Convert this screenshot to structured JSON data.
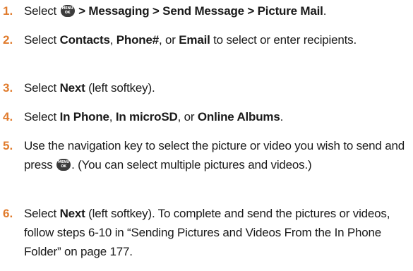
{
  "steps": [
    {
      "number": "1.",
      "parts": [
        {
          "t": "Select "
        },
        {
          "icon": "menu-ok-key"
        },
        {
          "b": " > Messaging > Send Message > Picture Mail"
        },
        {
          "t": "."
        }
      ]
    },
    {
      "number": "2.",
      "parts": [
        {
          "t": "Select "
        },
        {
          "b": "Contacts"
        },
        {
          "t": ", "
        },
        {
          "b": "Phone#"
        },
        {
          "t": ", or "
        },
        {
          "b": "Email"
        },
        {
          "t": " to select or enter recipients."
        }
      ]
    },
    {
      "number": "3.",
      "parts": [
        {
          "t": "Select "
        },
        {
          "b": "Next"
        },
        {
          "t": " (left softkey)."
        }
      ]
    },
    {
      "number": "4.",
      "parts": [
        {
          "t": "Select "
        },
        {
          "b": "In Phone"
        },
        {
          "t": ", "
        },
        {
          "b": "In microSD"
        },
        {
          "t": ", or "
        },
        {
          "b": "Online Albums"
        },
        {
          "t": "."
        }
      ]
    },
    {
      "number": "5.",
      "parts": [
        {
          "t": "Use the navigation key to select the picture or video you wish to send and press "
        },
        {
          "icon": "menu-ok-key"
        },
        {
          "t": ". (You can select multiple pictures and videos.)"
        }
      ]
    },
    {
      "number": "6.",
      "parts": [
        {
          "t": "Select "
        },
        {
          "b": "Next"
        },
        {
          "t": " (left softkey). To complete and send the pictures or videos, follow steps 6-10 in “Sending Pictures and Videos From the In Phone Folder” on page 177."
        }
      ]
    }
  ],
  "menu_key": {
    "line1": "MENU",
    "line2": "OK",
    "color": "#3c3c3c"
  },
  "colors": {
    "number": "#e07b2c",
    "text": "#1a1a1a"
  }
}
